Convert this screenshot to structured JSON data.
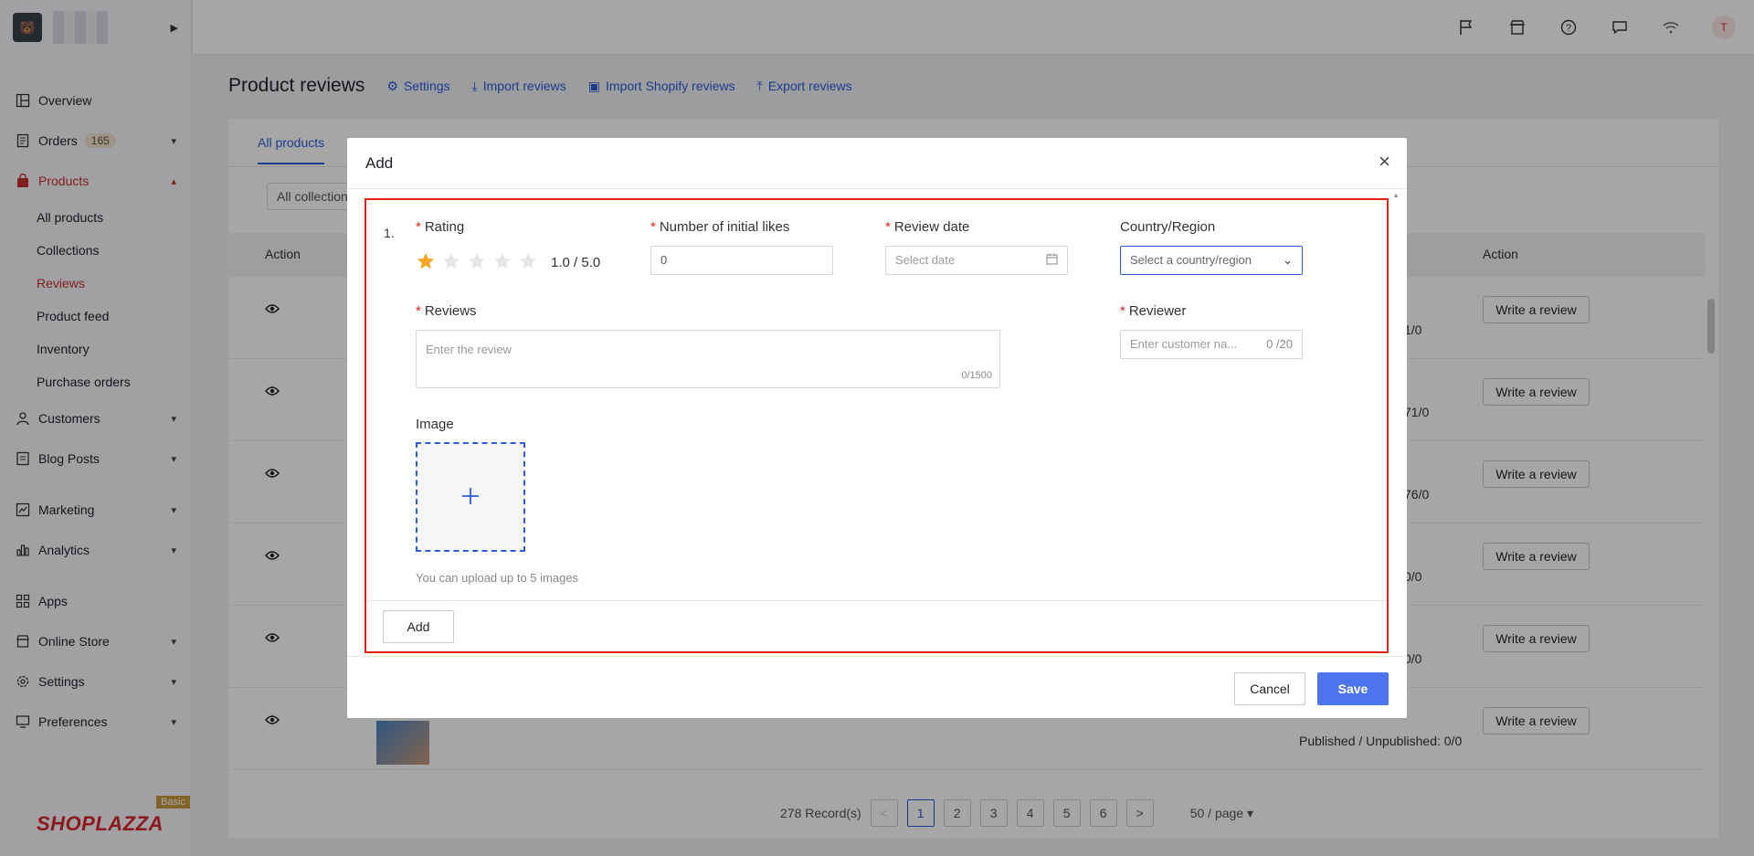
{
  "sidebar": {
    "items": [
      {
        "label": "Overview",
        "icon": "dashboard-icon"
      },
      {
        "label": "Orders",
        "badge": "165",
        "icon": "orders-icon"
      },
      {
        "label": "Products",
        "icon": "bag-icon"
      },
      {
        "label": "Customers",
        "icon": "user-icon"
      },
      {
        "label": "Blog Posts",
        "icon": "blog-icon"
      },
      {
        "label": "Marketing",
        "icon": "marketing-icon"
      },
      {
        "label": "Analytics",
        "icon": "analytics-icon"
      },
      {
        "label": "Apps",
        "icon": "apps-icon"
      },
      {
        "label": "Online Store",
        "icon": "store-icon"
      },
      {
        "label": "Settings",
        "icon": "gear-icon"
      },
      {
        "label": "Preferences",
        "icon": "monitor-icon"
      }
    ],
    "products_sub": [
      "All products",
      "Collections",
      "Reviews",
      "Product feed",
      "Inventory",
      "Purchase orders"
    ],
    "brand": "SHOPLAZZA",
    "tier": "Basic"
  },
  "topbar": {
    "avatar_letter": "T",
    "icons": [
      "flag-icon",
      "storefront-icon",
      "help-icon",
      "chat-icon",
      "wifi-icon"
    ]
  },
  "page": {
    "title": "Product reviews",
    "links": {
      "settings": "Settings",
      "import_reviews": "Import reviews",
      "import_shopify": "Import Shopify reviews",
      "export_reviews": "Export reviews"
    },
    "tab_active": "All products",
    "filter": "All collections",
    "table": {
      "col_action_left": "Action",
      "col_action_right": "Action",
      "write_review": "Write a review",
      "rows_pub": [
        "1/0",
        "71/0",
        "76/0",
        "0/0",
        "0/0",
        "Published / Unpublished: 0/0"
      ]
    },
    "pager": {
      "records": "278 Record(s)",
      "pages": [
        "1",
        "2",
        "3",
        "4",
        "5",
        "6"
      ],
      "prev": "<",
      "next": ">",
      "per_page": "50 / page"
    }
  },
  "modal": {
    "title": "Add",
    "close": "×",
    "index": "1.",
    "rating_label": "Rating",
    "rating_value": 1,
    "rating_max": 5,
    "rating_text": "1.0 / 5.0",
    "likes_label": "Number of initial likes",
    "likes_value": "0",
    "date_label": "Review date",
    "date_placeholder": "Select date",
    "country_label": "Country/Region",
    "country_placeholder": "Select a country/region",
    "reviews_label": "Reviews",
    "reviews_placeholder": "Enter the review",
    "reviews_count": "0/1500",
    "reviewer_label": "Reviewer",
    "reviewer_placeholder": "Enter customer na...",
    "reviewer_count": "0 /20",
    "image_label": "Image",
    "upload_hint": "You can upload up to 5 images",
    "add_label": "Add",
    "cancel_label": "Cancel",
    "save_label": "Save"
  }
}
